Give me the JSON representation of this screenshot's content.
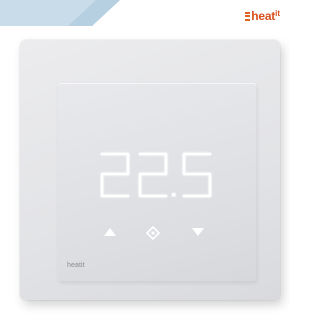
{
  "brand": {
    "word": "heat",
    "suffix": "it",
    "color": "#d94f1c"
  },
  "device": {
    "display_value": "22.5",
    "panel_label": "heatit",
    "display_color": "#ffffff",
    "controls": [
      "up-arrow-icon",
      "power-icon",
      "down-arrow-icon"
    ]
  }
}
